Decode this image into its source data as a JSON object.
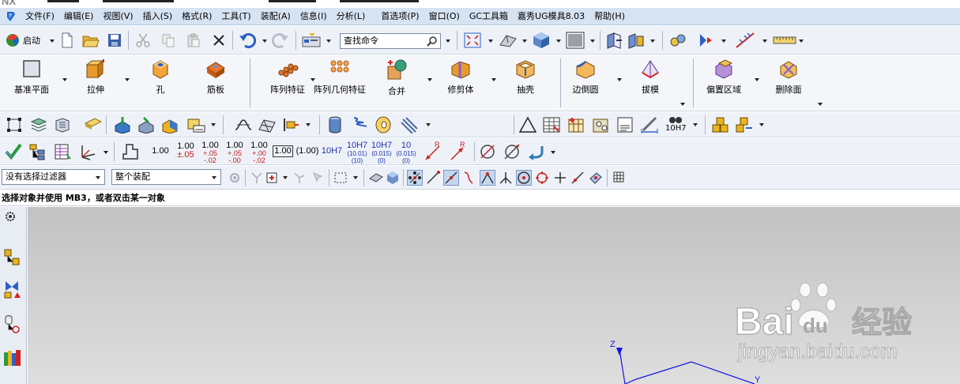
{
  "menubar": {
    "items": [
      "文件(F)",
      "编辑(E)",
      "视图(V)",
      "插入(S)",
      "格式(R)",
      "工具(T)",
      "装配(A)",
      "信息(I)",
      "分析(L)",
      "首选项(P)",
      "窗口(O)",
      "GC工具箱",
      "嘉秀UG模具8.03",
      "帮助(H)"
    ]
  },
  "toolbar1": {
    "start_label": "启动",
    "search_placeholder": "查找命令"
  },
  "feature_toolbar": {
    "buttons": [
      "基准平面",
      "拉伸",
      "孔",
      "筋板",
      "阵列特征",
      "阵列几何特征",
      "合并",
      "修剪体",
      "抽壳",
      "边倒圆",
      "拔模",
      "偏置区域",
      "删除面"
    ]
  },
  "toolbar3": {
    "fit_label": "10H7"
  },
  "pmi_toolbar": {
    "n1": "1.00",
    "n2_top": "1.00",
    "n2_bot": "±.05",
    "n3_top": "1.00",
    "n3_a": "+.05",
    "n3_b": "-.02",
    "n4_top": "1.00",
    "n4_a": "+.05",
    "n4_b": "-.00",
    "n5_top": "1.00",
    "n5_a": "+.00",
    "n5_b": "-.02",
    "n6": "1.00",
    "n7": "(1.00)",
    "f1": "10H7",
    "f2_top": "10H7",
    "f2_a": "(10.01)",
    "f2_b": "(10)",
    "f3_top": "10H7",
    "f3_a": "(0.015)",
    "f3_b": "(0)",
    "f4_top": "10",
    "f4_a": "(0.015)",
    "f4_b": "(0)",
    "r1": "R",
    "r2": "R"
  },
  "selection_bar": {
    "filter_value": "没有选择过滤器",
    "scope_value": "整个装配"
  },
  "status": {
    "prompt": "选择对象并使用 MB3，或者双击某一对象"
  },
  "viewport": {
    "axis_z": "Z",
    "axis_y": "Y"
  },
  "watermark": {
    "brand": "Bai",
    "du": "du",
    "suffix": "经验",
    "url": "jingyan.baidu.com"
  },
  "colors": {
    "menubar_bg": "#d6e3f2",
    "toolbar_bg": "#eef2f8",
    "viewport_top": "#c2c2c2",
    "axis_blue": "#1515e0"
  }
}
